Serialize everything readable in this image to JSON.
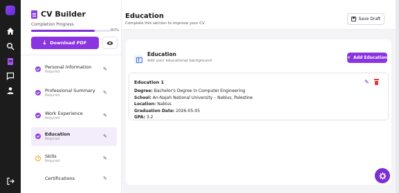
{
  "sidebar": {
    "title": "CV Builder",
    "progress_label": "Completion Progress",
    "progress_value": 0.8,
    "progress_pct": "80%",
    "download_label": "Download PDF",
    "items": [
      {
        "label": "Personal Information",
        "sub": "Required",
        "status": "done"
      },
      {
        "label": "Professional Summary",
        "sub": "Required",
        "status": "done"
      },
      {
        "label": "Work Experience",
        "sub": "Required",
        "status": "done"
      },
      {
        "label": "Education",
        "sub": "Required",
        "status": "done"
      },
      {
        "label": "Skills",
        "sub": "Required",
        "status": "pending"
      },
      {
        "label": "Certifications",
        "sub": "",
        "status": "none"
      }
    ]
  },
  "header": {
    "title": "Education",
    "subtitle": "Complete this section to improve your CV",
    "save_label": "Save Draft"
  },
  "section": {
    "title": "Education",
    "subtitle": "Add your educational background",
    "add_label": "Add Education"
  },
  "entry": {
    "title": "Education 1",
    "degree_label": "Degree:",
    "degree": "Bachelor's Degree in Computer Engineering",
    "school_label": "School:",
    "school": "An-Najah National University – Nablus, Palestine",
    "location_label": "Location:",
    "location": "Nablus",
    "grad_label": "Graduation Date:",
    "grad": "2026-05-05",
    "gpa_label": "GPA:",
    "gpa": "3.2"
  },
  "colors": {
    "accent": "#8a34e2",
    "rail": "#1c1c1c",
    "delete": "#e53935",
    "pending": "#f0a020"
  }
}
